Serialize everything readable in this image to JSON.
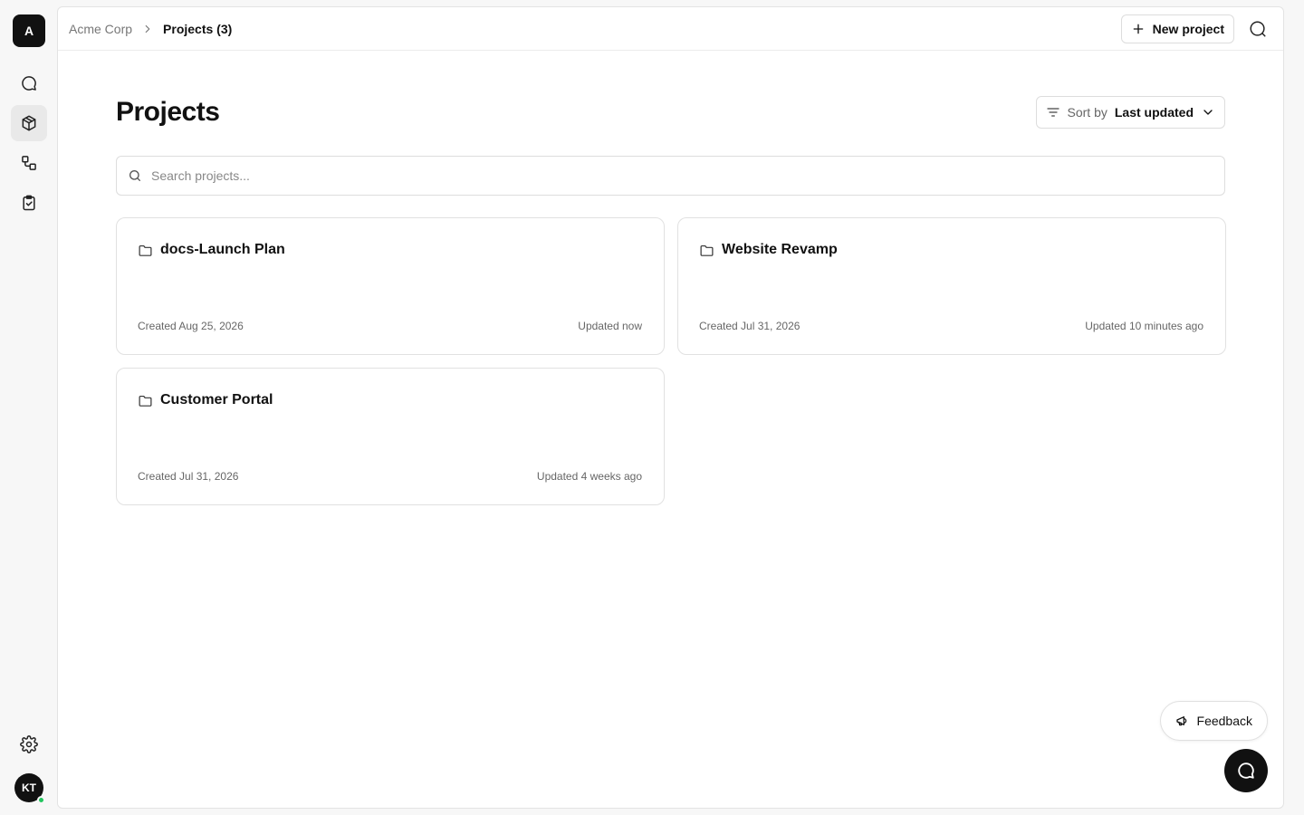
{
  "org": {
    "avatar_letter": "A",
    "name": "Acme Corp"
  },
  "rail": {
    "items": [
      {
        "icon": "chat-icon",
        "label": "Chat"
      },
      {
        "icon": "box-icon",
        "label": "Projects",
        "active": true
      },
      {
        "icon": "workflow-icon",
        "label": "Workflows"
      },
      {
        "icon": "clipboard-check-icon",
        "label": "Tasks"
      }
    ],
    "settings_icon": "gear-icon",
    "user_initials": "KT",
    "presence_color": "#22c55e"
  },
  "breadcrumb": {
    "org": "Acme Corp",
    "current": "Projects (3)"
  },
  "toolbar": {
    "new_project_label": "New project",
    "search_icon": "search-icon"
  },
  "page": {
    "title": "Projects",
    "sort_prefix": "Sort by",
    "sort_value": "Last updated",
    "search_placeholder": "Search projects..."
  },
  "projects": [
    {
      "name": "docs-Launch Plan",
      "created": "Created Aug 25, 2026",
      "updated": "Updated now"
    },
    {
      "name": "Website Revamp",
      "created": "Created Jul 31, 2026",
      "updated": "Updated 10 minutes ago"
    },
    {
      "name": "Customer Portal",
      "created": "Created Jul 31, 2026",
      "updated": "Updated 4 weeks ago"
    }
  ],
  "floating": {
    "feedback_label": "Feedback",
    "chat_icon": "chat-bubble-icon"
  },
  "colors": {
    "accent": "#111111",
    "background": "#f7f7f7",
    "presence": "#22c55e"
  }
}
